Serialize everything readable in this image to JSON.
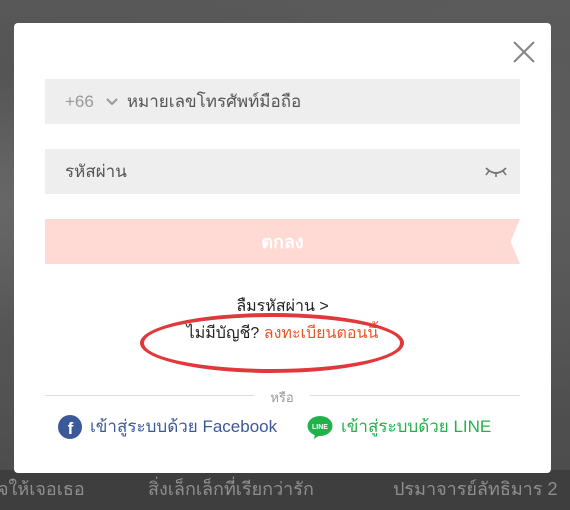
{
  "background": {
    "captions": [
      "จให้เจอเธอ",
      "สิ่งเล็กเล็กที่เรียกว่ารัก",
      "ปรมาจารย์ลัทธิมาร 2"
    ]
  },
  "login": {
    "country_code": "+66",
    "phone_placeholder": "หมายเลขโทรศัพท์มือถือ",
    "password_placeholder": "รหัสผ่าน",
    "submit_label": "ตกลง",
    "forgot_label": "ลืมรหัสผ่าน >",
    "no_account_label": "ไม่มีบัญชี?",
    "register_label": "ลงทะเบียนตอนนี้",
    "or_label": "หรือ",
    "facebook_label": "เข้าสู่ระบบด้วย Facebook",
    "line_label": "เข้าสู่ระบบด้วย LINE"
  },
  "icons": [
    "close-icon",
    "chevron-down-icon",
    "eye-closed-icon",
    "facebook-icon",
    "line-icon"
  ],
  "colors": {
    "accent_link": "#e8572a",
    "submit_disabled": "#ffd9d4",
    "facebook": "#3b5998",
    "line": "#21b24b",
    "annotation_oval": "#e0383b"
  }
}
